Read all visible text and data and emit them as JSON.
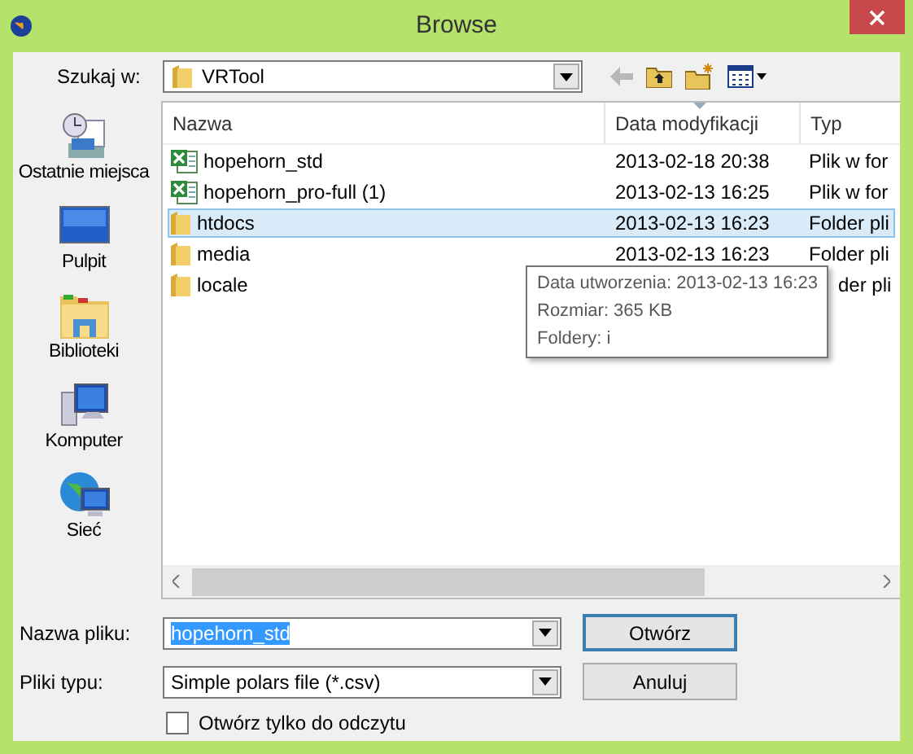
{
  "window": {
    "title": "Browse"
  },
  "look_in": {
    "label": "Szukaj w:",
    "value": "VRTool"
  },
  "sidebar": {
    "items": [
      {
        "label": "Ostatnie miejsca",
        "kind": "recent"
      },
      {
        "label": "Pulpit",
        "kind": "desktop"
      },
      {
        "label": "Biblioteki",
        "kind": "libraries"
      },
      {
        "label": "Komputer",
        "kind": "computer"
      },
      {
        "label": "Sieć",
        "kind": "network"
      }
    ]
  },
  "table": {
    "columns": [
      "Nazwa",
      "Data modyfikacji",
      "Typ"
    ],
    "rows": [
      {
        "kind": "spreadsheet",
        "name": "hopehorn_std",
        "date": "2013-02-18 20:38",
        "type": "Plik w for",
        "selected": false
      },
      {
        "kind": "spreadsheet",
        "name": "hopehorn_pro-full (1)",
        "date": "2013-02-13 16:25",
        "type": "Plik w for",
        "selected": false
      },
      {
        "kind": "folder",
        "name": "htdocs",
        "date": "2013-02-13 16:23",
        "type": "Folder pli",
        "selected": true
      },
      {
        "kind": "folder",
        "name": "media",
        "date": "2013-02-13 16:23",
        "type": "Folder pli",
        "selected": false
      },
      {
        "kind": "folder",
        "name": "locale",
        "type": "der pli",
        "selected": false
      }
    ]
  },
  "tooltip": {
    "lines": [
      "Data utworzenia: 2013-02-13 16:23",
      "Rozmiar: 365 KB",
      "Foldery: i"
    ]
  },
  "file_name": {
    "label": "Nazwa pliku:",
    "value": "hopehorn_std"
  },
  "file_type": {
    "label": "Pliki typu:",
    "value": "Simple polars file (*.csv)"
  },
  "read_only": {
    "label": "Otwórz tylko do odczytu",
    "checked": false
  },
  "buttons": [
    "Otwórz",
    "Anuluj"
  ]
}
